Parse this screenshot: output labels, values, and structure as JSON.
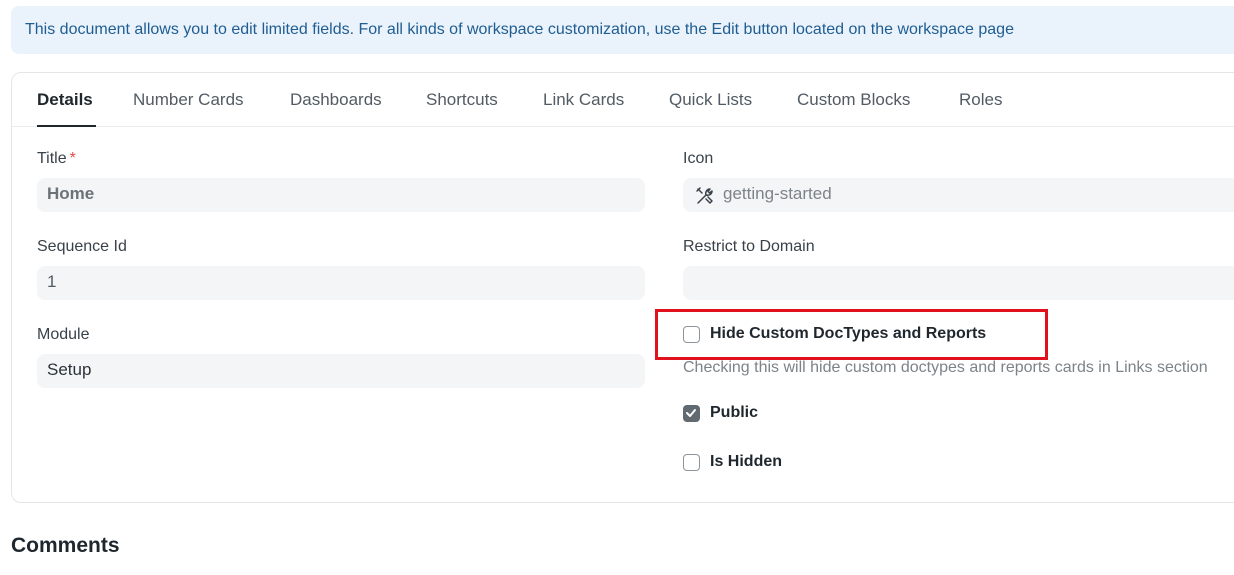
{
  "banner": {
    "text": "This document allows you to edit limited fields. For all kinds of workspace customization, use the Edit button located on the workspace page"
  },
  "tabs": [
    {
      "label": "Details",
      "active": true
    },
    {
      "label": "Number Cards"
    },
    {
      "label": "Dashboards"
    },
    {
      "label": "Shortcuts"
    },
    {
      "label": "Link Cards"
    },
    {
      "label": "Quick Lists"
    },
    {
      "label": "Custom Blocks"
    },
    {
      "label": "Roles"
    }
  ],
  "form": {
    "title": {
      "label": "Title",
      "required_mark": "*",
      "value": "Home"
    },
    "sequence_id": {
      "label": "Sequence Id",
      "value": "1"
    },
    "module": {
      "label": "Module",
      "value": "Setup"
    },
    "icon": {
      "label": "Icon",
      "value": "getting-started",
      "icon": "tools-icon"
    },
    "restrict_to_domain": {
      "label": "Restrict to Domain",
      "value": ""
    },
    "hide_custom": {
      "label": "Hide Custom DocTypes and Reports",
      "checked": false,
      "description": "Checking this will hide custom doctypes and reports cards in Links section"
    },
    "public": {
      "label": "Public",
      "checked": true
    },
    "is_hidden": {
      "label": "Is Hidden",
      "checked": false
    }
  },
  "comments": {
    "heading": "Comments"
  },
  "colors": {
    "highlight": "#e1121e",
    "banner_bg": "#eaf3fb",
    "banner_text": "#1f5d92"
  }
}
